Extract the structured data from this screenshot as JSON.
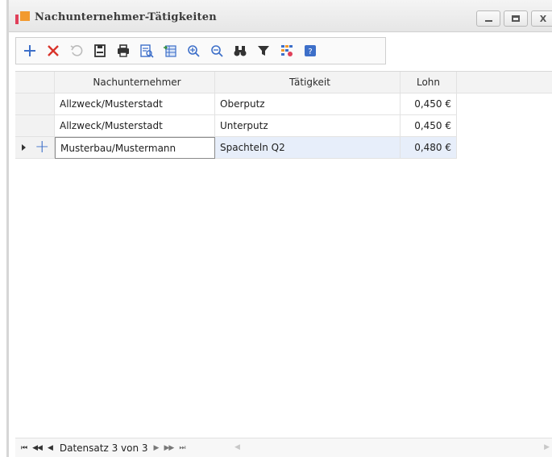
{
  "window": {
    "title": "Nachunternehmer-Tätigkeiten",
    "controls": [
      "minimize-icon",
      "maximize-icon",
      "close-icon"
    ],
    "close_label": "X"
  },
  "toolbar": {
    "buttons": [
      "add-icon",
      "delete-icon",
      "undo-icon",
      "save-icon",
      "print-icon",
      "print-preview-icon",
      "export-icon",
      "zoom-in-icon",
      "zoom-out-icon",
      "find-icon",
      "filter-icon",
      "column-chooser-icon",
      "help-icon"
    ]
  },
  "grid": {
    "columns": [
      "Nachunternehmer",
      "Tätigkeit",
      "Lohn"
    ],
    "rows": [
      {
        "nachunternehmer": "Allzweck/Musterstadt",
        "taetigkeit": "Oberputz",
        "lohn": "0,450 €"
      },
      {
        "nachunternehmer": "Allzweck/Musterstadt",
        "taetigkeit": "Unterputz",
        "lohn": "0,450 €"
      },
      {
        "nachunternehmer": "Musterbau/Mustermann",
        "taetigkeit": "Spachteln Q2",
        "lohn": "0,480 €"
      }
    ],
    "selected_row": 3
  },
  "navigator": {
    "first": "⏮",
    "prev_page": "◀◀",
    "prev": "◀",
    "record_text": "Datensatz 3 von 3",
    "next": "▶",
    "next_page": "▶▶",
    "last": "⏭"
  },
  "colors": {
    "accent_blue": "#3d6fc9",
    "delete_red": "#d9342b",
    "selected_row": "#e7eefa"
  }
}
